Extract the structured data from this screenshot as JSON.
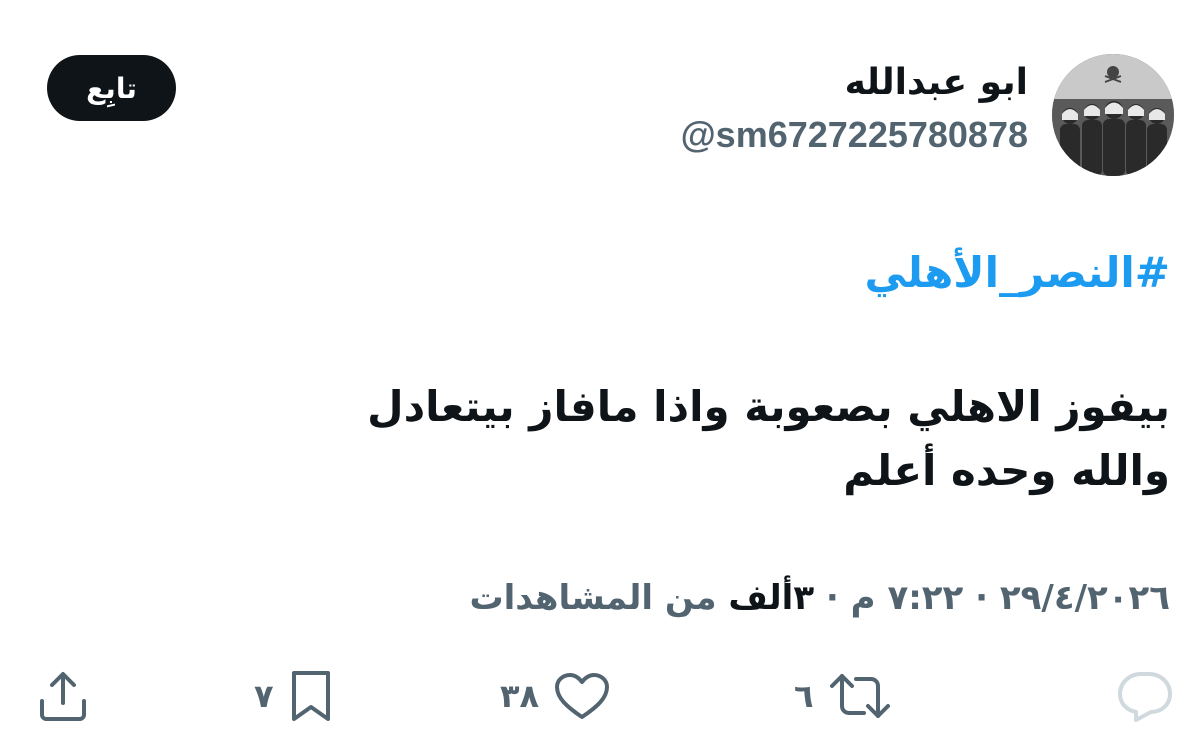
{
  "header": {
    "display_name": "ابو عبدالله",
    "handle": "@sm6727225780878",
    "follow_label": "تابِع"
  },
  "tweet": {
    "hashtag": "#النصر_الأهلي",
    "text_lines": [
      "بيفوز الاهلي بصعوبة واذا مافاز بيتعادل",
      "والله وحده أعلم"
    ]
  },
  "meta": {
    "date_time": "٢٩/٤/٢٠٢٦ · ٧:٢٢ م · ",
    "views_count": "٣ألف",
    "views_label": " من المشاهدات"
  },
  "actions": {
    "reply_icon": "reply-icon",
    "retweet_count": "٦",
    "like_count": "٣٨",
    "bookmark_count": "٧",
    "share_icon": "share-icon"
  },
  "colors": {
    "text_primary": "#0f1419",
    "text_secondary": "#536471",
    "hashtag": "#1d9bf0",
    "reply_icon_muted": "#cfd9de"
  }
}
